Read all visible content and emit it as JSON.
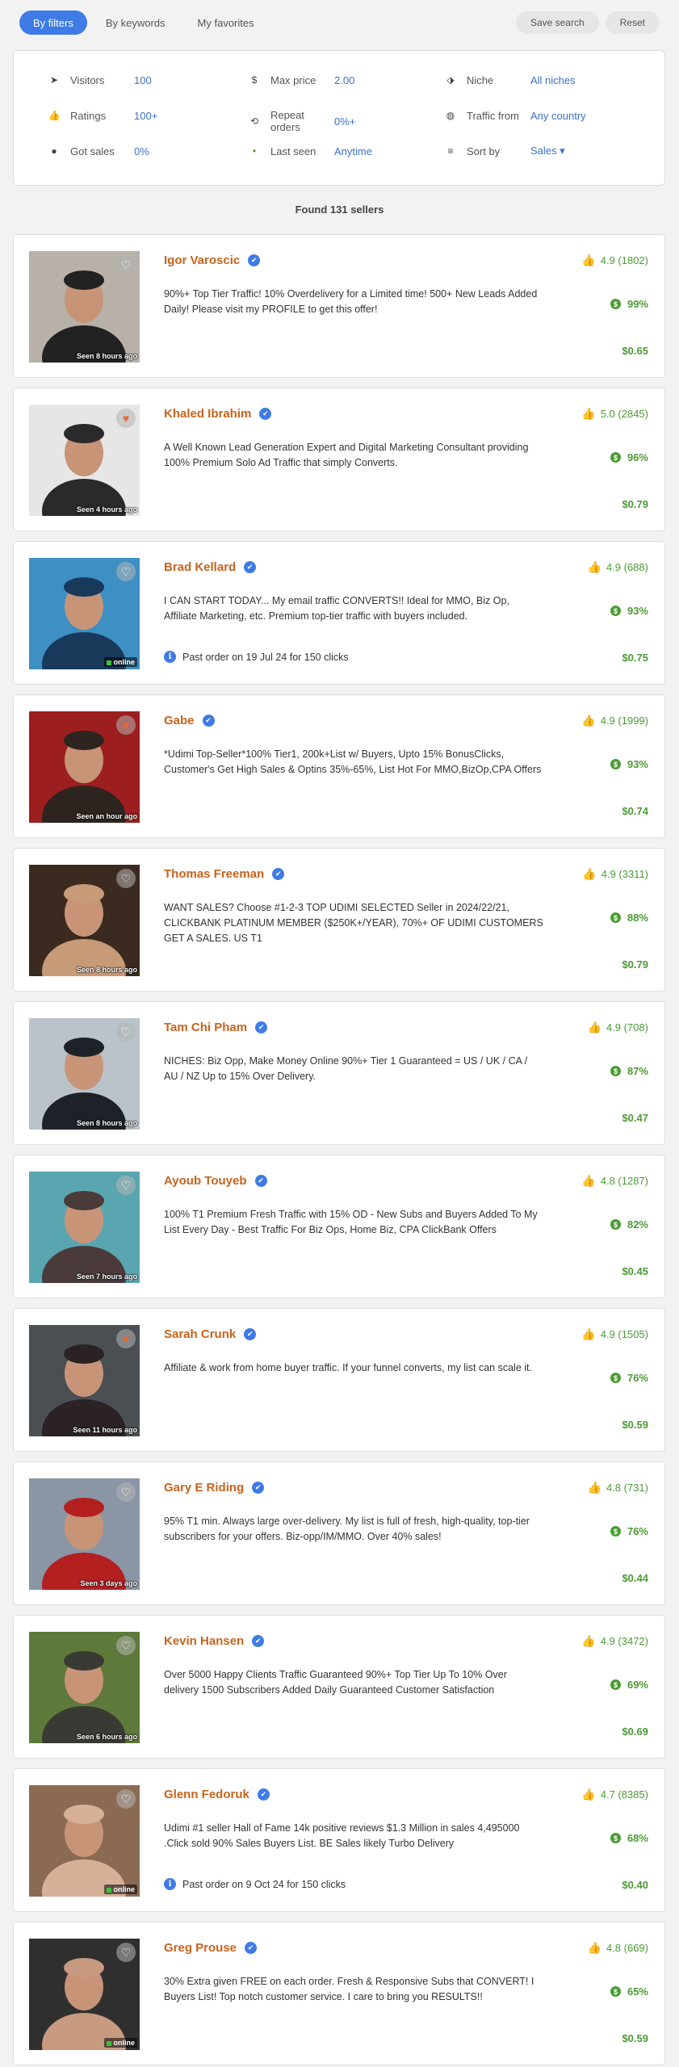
{
  "tabs": [
    {
      "label": "By filters",
      "active": true
    },
    {
      "label": "By keywords",
      "active": false
    },
    {
      "label": "My favorites",
      "active": false
    }
  ],
  "actions": {
    "save": "Save search",
    "reset": "Reset"
  },
  "filters": [
    {
      "icon": "navigation-arrow-icon",
      "glyph": "➤",
      "label": "Visitors",
      "value": "100"
    },
    {
      "icon": "dollar-icon",
      "glyph": "$",
      "label": "Max price",
      "value": "2.00"
    },
    {
      "icon": "tag-icon",
      "glyph": "⬗",
      "label": "Niche",
      "value": "All niches"
    },
    {
      "icon": "thumbs-up-icon",
      "glyph": "👍",
      "label": "Ratings",
      "value": "100+"
    },
    {
      "icon": "repeat-icon",
      "glyph": "⟲",
      "label": "Repeat orders",
      "value": "0%+"
    },
    {
      "icon": "globe-icon",
      "glyph": "◍",
      "label": "Traffic from",
      "value": "Any country"
    },
    {
      "icon": "coin-icon",
      "glyph": "●",
      "label": "Got sales",
      "value": "0%"
    },
    {
      "icon": "online-dot-icon",
      "glyph": "•",
      "label": "Last seen",
      "value": "Anytime"
    },
    {
      "icon": "sort-icon",
      "glyph": "≡",
      "label": "Sort by",
      "value": "Sales ▾"
    }
  ],
  "found": "Found 131 sellers",
  "colors": {
    "accent": "#3f7be6",
    "name": "#c8631c",
    "green": "#4b9b34"
  },
  "sellers": [
    {
      "name": "Igor Varoscic",
      "rating": "4.9 (1802)",
      "sales": "99%",
      "price": "$0.65",
      "status": "Seen 8 hours ago",
      "online": false,
      "fav": false,
      "order": "",
      "desc": "90%+ Top Tier Traffic! 10% Overdelivery for a Limited time! 500+ New Leads Added Daily! Please visit my PROFILE to get this offer!",
      "bg": "#b7b1aa",
      "fg": "#222"
    },
    {
      "name": "Khaled Ibrahim",
      "rating": "5.0 (2845)",
      "sales": "96%",
      "price": "$0.79",
      "status": "Seen 4 hours ago",
      "online": false,
      "fav": true,
      "order": "",
      "desc": "A Well Known Lead Generation Expert and Digital Marketing Consultant providing 100% Premium Solo Ad Traffic that simply Converts.",
      "bg": "#e6e6e6",
      "fg": "#2a2a2a"
    },
    {
      "name": "Brad Kellard",
      "rating": "4.9 (688)",
      "sales": "93%",
      "price": "$0.75",
      "status": "online",
      "online": true,
      "fav": false,
      "order": "Past order on 19 Jul 24 for 150 clicks",
      "desc": "I CAN START TODAY... My email traffic CONVERTS!! Ideal for MMO, Biz Op, Affiliate Marketing, etc. Premium top-tier traffic with buyers included.",
      "bg": "#3d8fc4",
      "fg": "#19395a"
    },
    {
      "name": "Gabe",
      "rating": "4.9 (1999)",
      "sales": "93%",
      "price": "$0.74",
      "status": "Seen an hour ago",
      "online": false,
      "fav": true,
      "order": "",
      "desc": "*Udimi Top-Seller*100% Tier1, 200k+List w/ Buyers, Upto 15% BonusClicks, Customer's Get High Sales & Optins 35%-65%, List Hot For MMO,BizOp,CPA Offers",
      "bg": "#9c1e1e",
      "fg": "#2d2420"
    },
    {
      "name": "Thomas Freeman",
      "rating": "4.9 (3311)",
      "sales": "88%",
      "price": "$0.79",
      "status": "Seen 8 hours ago",
      "online": false,
      "fav": false,
      "order": "",
      "desc": "WANT SALES? Choose #1-2-3 TOP UDIMI SELECTED Seller in 2024/22/21, CLICKBANK PLATINUM MEMBER ($250K+/YEAR), 70%+ OF UDIMI CUSTOMERS GET A SALES. US T1",
      "bg": "#3a2a1f",
      "fg": "#c79a78"
    },
    {
      "name": "Tam Chi Pham",
      "rating": "4.9 (708)",
      "sales": "87%",
      "price": "$0.47",
      "status": "Seen 8 hours ago",
      "online": false,
      "fav": false,
      "order": "",
      "desc": "NICHES: Biz Opp, Make Money Online 90%+ Tier 1 Guaranteed = US / UK / CA / AU / NZ Up to 15% Over Delivery.",
      "bg": "#b9c3c9",
      "fg": "#1d2228"
    },
    {
      "name": "Ayoub Touyeb",
      "rating": "4.8 (1287)",
      "sales": "82%",
      "price": "$0.45",
      "status": "Seen 7 hours ago",
      "online": false,
      "fav": false,
      "order": "",
      "desc": "100% T1 Premium Fresh Traffic with 15% OD - New Subs and Buyers Added To My List Every Day - Best Traffic For Biz Ops, Home Biz, CPA ClickBank Offers",
      "bg": "#5aa6b0",
      "fg": "#4a3a3a"
    },
    {
      "name": "Sarah Crunk",
      "rating": "4.9 (1505)",
      "sales": "76%",
      "price": "$0.59",
      "status": "Seen 11 hours ago",
      "online": false,
      "fav": true,
      "order": "",
      "desc": "Affiliate & work from home buyer traffic. If your funnel converts, my list can scale it.",
      "bg": "#4a4f54",
      "fg": "#2a2225"
    },
    {
      "name": "Gary E Riding",
      "rating": "4.8 (731)",
      "sales": "76%",
      "price": "$0.44",
      "status": "Seen 3 days ago",
      "online": false,
      "fav": false,
      "order": "",
      "desc": "95% T1 min. Always large over-delivery. My list is full of fresh, high-quality, top-tier subscribers for your offers. Biz-opp/IM/MMO. Over 40% sales!",
      "bg": "#8a96a6",
      "fg": "#b42020"
    },
    {
      "name": "Kevin Hansen",
      "rating": "4.9 (3472)",
      "sales": "69%",
      "price": "$0.69",
      "status": "Seen 6 hours ago",
      "online": false,
      "fav": false,
      "order": "",
      "desc": "Over 5000 Happy Clients Traffic Guaranteed 90%+ Top Tier Up To 10% Over delivery 1500 Subscribers Added Daily Guaranteed Customer Satisfaction",
      "bg": "#5e7a3a",
      "fg": "#3a3a35"
    },
    {
      "name": "Glenn Fedoruk",
      "rating": "4.7 (8385)",
      "sales": "68%",
      "price": "$0.40",
      "status": "online",
      "online": true,
      "fav": false,
      "order": "Past order on 9 Oct 24 for 150 clicks",
      "desc": "Udimi #1 seller Hall of Fame 14k positive reviews $1.3 Million in sales 4,495000 .Click sold 90% Sales Buyers List. BE Sales likely Turbo Delivery",
      "bg": "#8a6a52",
      "fg": "#d7b09a"
    },
    {
      "name": "Greg Prouse",
      "rating": "4.8 (669)",
      "sales": "65%",
      "price": "$0.59",
      "status": "online",
      "online": true,
      "fav": false,
      "order": "",
      "desc": "30% Extra given FREE on each order. Fresh & Responsive Subs that CONVERT! I Buyers List! Top notch customer service. I care to bring you RESULTS!!",
      "bg": "#2f2f2f",
      "fg": "#c89a80"
    }
  ]
}
